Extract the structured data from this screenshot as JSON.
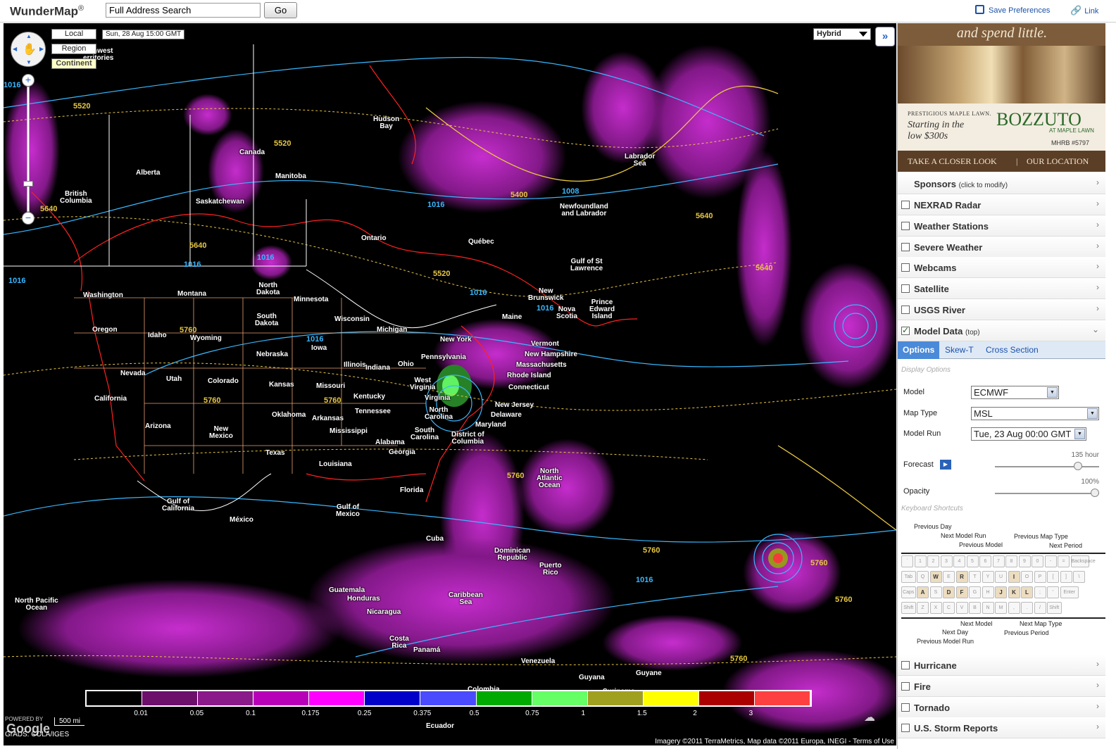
{
  "header": {
    "logo": "WunderMap",
    "logo_mark": "®",
    "search_value": "Full Address Search",
    "go_label": "Go",
    "save_prefs_label": "Save Preferences",
    "link_label": "Link"
  },
  "map": {
    "scale_buttons": {
      "local": "Local",
      "region": "Region",
      "continent": "Continent"
    },
    "time": "Sun, 28 Aug 15:00 GMT",
    "map_type": "Hybrid",
    "expand_icon": "»",
    "legend": {
      "colors": [
        "#000000",
        "#6b0f6b",
        "#8a198a",
        "#b800b8",
        "#ff00ff",
        "#0000c8",
        "#4a4aff",
        "#00aa00",
        "#66ff66",
        "#a0a020",
        "#ffff00",
        "#aa0000",
        "#ff4040"
      ],
      "ticks": [
        "0.01",
        "0.05",
        "0.1",
        "0.175",
        "0.25",
        "0.375",
        "0.5",
        "0.75",
        "1",
        "1.5",
        "2",
        "3"
      ]
    },
    "powered_by": "POWERED BY",
    "google": "Google",
    "grads": "GrADS: COLA/IGES",
    "scale": "500 mi",
    "copyright": "Imagery ©2011 TerraMetrics, Map data ©2011 Europa, INEGI - Terms of Use",
    "labels": [
      {
        "text": "Northwest Territories"
      },
      {
        "text": "Hudson Bay"
      },
      {
        "text": "Canada"
      },
      {
        "text": "Alberta"
      },
      {
        "text": "Manitoba"
      },
      {
        "text": "British Columbia"
      },
      {
        "text": "Saskatchewan"
      },
      {
        "text": "Ontario"
      },
      {
        "text": "Québec"
      },
      {
        "text": "Labrador Sea"
      },
      {
        "text": "Newfoundland and Labrador"
      },
      {
        "text": "Gulf of St Lawrence"
      },
      {
        "text": "New Brunswick"
      },
      {
        "text": "Prince Edward Island"
      },
      {
        "text": "Nova Scotia"
      },
      {
        "text": "Maine"
      },
      {
        "text": "Vermont"
      },
      {
        "text": "New Hampshire"
      },
      {
        "text": "Massachusetts"
      },
      {
        "text": "Rhode Island"
      },
      {
        "text": "Connecticut"
      },
      {
        "text": "New York"
      },
      {
        "text": "Pennsylvania"
      },
      {
        "text": "New Jersey"
      },
      {
        "text": "Delaware"
      },
      {
        "text": "Maryland"
      },
      {
        "text": "District of Columbia"
      },
      {
        "text": "West Virginia"
      },
      {
        "text": "Virginia"
      },
      {
        "text": "North Carolina"
      },
      {
        "text": "South Carolina"
      },
      {
        "text": "Georgia"
      },
      {
        "text": "Florida"
      },
      {
        "text": "Washington"
      },
      {
        "text": "Montana"
      },
      {
        "text": "North Dakota"
      },
      {
        "text": "Minnesota"
      },
      {
        "text": "Oregon"
      },
      {
        "text": "Idaho"
      },
      {
        "text": "Wyoming"
      },
      {
        "text": "South Dakota"
      },
      {
        "text": "Wisconsin"
      },
      {
        "text": "Michigan"
      },
      {
        "text": "Iowa"
      },
      {
        "text": "Nebraska"
      },
      {
        "text": "Illinois"
      },
      {
        "text": "Indiana"
      },
      {
        "text": "Ohio"
      },
      {
        "text": "Nevada"
      },
      {
        "text": "Utah"
      },
      {
        "text": "Colorado"
      },
      {
        "text": "Kansas"
      },
      {
        "text": "Missouri"
      },
      {
        "text": "Kentucky"
      },
      {
        "text": "California"
      },
      {
        "text": "Tennessee"
      },
      {
        "text": "Oklahoma"
      },
      {
        "text": "Arkansas"
      },
      {
        "text": "Arizona"
      },
      {
        "text": "New Mexico"
      },
      {
        "text": "Mississippi"
      },
      {
        "text": "Alabama"
      },
      {
        "text": "Texas"
      },
      {
        "text": "Louisiana"
      },
      {
        "text": "Gulf of California"
      },
      {
        "text": "Gulf of Mexico"
      },
      {
        "text": "México"
      },
      {
        "text": "Cuba"
      },
      {
        "text": "Dominican Republic"
      },
      {
        "text": "Puerto Rico"
      },
      {
        "text": "Caribbean Sea"
      },
      {
        "text": "Guatemala"
      },
      {
        "text": "Honduras"
      },
      {
        "text": "Nicaragua"
      },
      {
        "text": "Costa Rica"
      },
      {
        "text": "Panamá"
      },
      {
        "text": "Venezuela"
      },
      {
        "text": "Colombia"
      },
      {
        "text": "Guyana"
      },
      {
        "text": "Suriname"
      },
      {
        "text": "Guyane"
      },
      {
        "text": "North Atlantic Ocean"
      },
      {
        "text": "North Pacific Ocean"
      },
      {
        "text": "Ecuador"
      }
    ],
    "isobars": [
      {
        "text": "5520",
        "c": "y"
      },
      {
        "text": "5520",
        "c": "y"
      },
      {
        "text": "5640",
        "c": "y"
      },
      {
        "text": "5640",
        "c": "y"
      },
      {
        "text": "5400",
        "c": "y"
      },
      {
        "text": "5640",
        "c": "y"
      },
      {
        "text": "5640",
        "c": "y"
      },
      {
        "text": "5520",
        "c": "y"
      },
      {
        "text": "5760",
        "c": "y"
      },
      {
        "text": "5760",
        "c": "y"
      },
      {
        "text": "5760",
        "c": "y"
      },
      {
        "text": "5760",
        "c": "y"
      },
      {
        "text": "5760",
        "c": "y"
      },
      {
        "text": "5760",
        "c": "y"
      },
      {
        "text": "5760",
        "c": "y"
      },
      {
        "text": "5760",
        "c": "y"
      },
      {
        "text": "1016",
        "c": "b"
      },
      {
        "text": "1016",
        "c": "b"
      },
      {
        "text": "1016",
        "c": "b"
      },
      {
        "text": "1008",
        "c": "b"
      },
      {
        "text": "1016",
        "c": "b"
      },
      {
        "text": "1016",
        "c": "b"
      },
      {
        "text": "1016",
        "c": "b"
      },
      {
        "text": "1016",
        "c": "b"
      },
      {
        "text": "1016",
        "c": "b"
      },
      {
        "text": "1016",
        "c": "b"
      }
    ]
  },
  "ad": {
    "tagline": "and spend little.",
    "promo_pre": "PRESTIGIOUS MAPLE LAWN.",
    "promo_1": "Starting in the",
    "promo_2": "low $300s",
    "brand": "BOZZUTO",
    "brand_sub": "AT MAPLE LAWN",
    "mhrb": "MHRB #5797",
    "cta_left": "TAKE A CLOSER LOOK",
    "cta_sep": "|",
    "cta_right": "OUR LOCATION"
  },
  "sidebar": {
    "sponsors": "Sponsors",
    "sponsors_note": "(click to modify)",
    "layers": [
      "NEXRAD Radar",
      "Weather Stations",
      "Severe Weather",
      "Webcams",
      "Satellite",
      "USGS River"
    ],
    "model_data": "Model Data",
    "model_data_note": "(top)",
    "tabs": [
      "Options",
      "Skew-T",
      "Cross Section"
    ],
    "display_options": "Display Options",
    "model_label": "Model",
    "model_value": "ECMWF",
    "maptype_label": "Map Type",
    "maptype_value": "MSL",
    "run_label": "Model Run",
    "run_value": "Tue, 23 Aug 00:00 GMT",
    "forecast_label": "Forecast",
    "forecast_value": "135 hour",
    "opacity_label": "Opacity",
    "opacity_value": "100%",
    "shortcuts_label": "Keyboard Shortcuts",
    "kb_labels": {
      "prev_day": "Previous Day",
      "next_run": "Next Model Run",
      "prev_model": "Previous Model",
      "prev_maptype": "Previous Map Type",
      "next_period": "Next Period",
      "next_model": "Next Model",
      "next_day": "Next Day",
      "prev_run": "Previous Model Run",
      "next_maptype": "Next Map Type",
      "prev_period": "Previous Period"
    },
    "bottom_layers": [
      "Hurricane",
      "Fire",
      "Tornado",
      "U.S. Storm Reports"
    ]
  }
}
